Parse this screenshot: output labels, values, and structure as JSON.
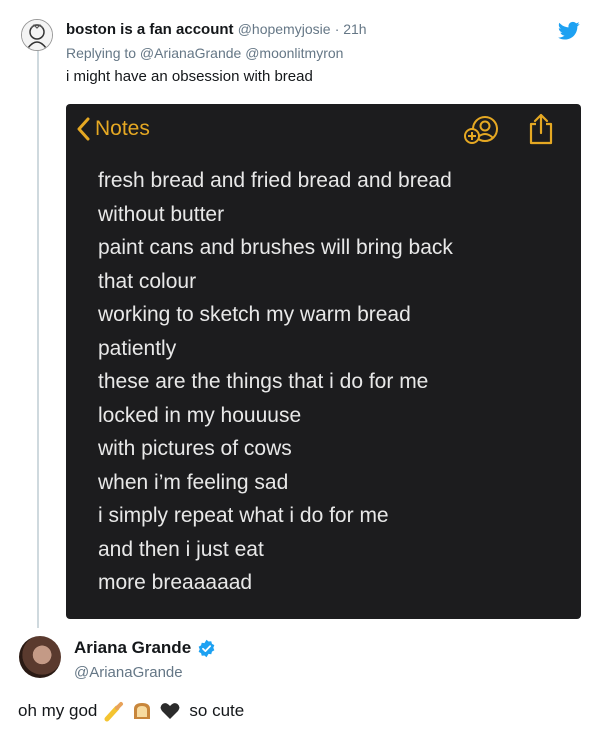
{
  "tweet": {
    "name": "boston is a fan account",
    "handle": "@hopemyjosie",
    "time": "· 21h",
    "reply_to": "Replying to @ArianaGrande @moonlitmyron",
    "text": "i might have an obsession with bread"
  },
  "notes": {
    "back_label": "Notes",
    "accent_color": "#e5a823",
    "lines": [
      "fresh bread and fried bread and bread",
      "without butter",
      "paint cans and brushes will bring back",
      "that colour",
      "working to sketch my warm bread",
      "patiently",
      "these are the things that i do for me",
      "locked in my houuuse",
      "with pictures of cows",
      "when i’m feeling sad",
      "i simply repeat what i do for me",
      "and then i just eat",
      "more breaaaaad"
    ]
  },
  "reply": {
    "name": "Ariana Grande",
    "handle": "@ArianaGrande",
    "text_start": "oh my god",
    "emojis": [
      "paintbrush-icon",
      "bread-icon",
      "black-heart-icon"
    ],
    "text_end": "so cute"
  }
}
